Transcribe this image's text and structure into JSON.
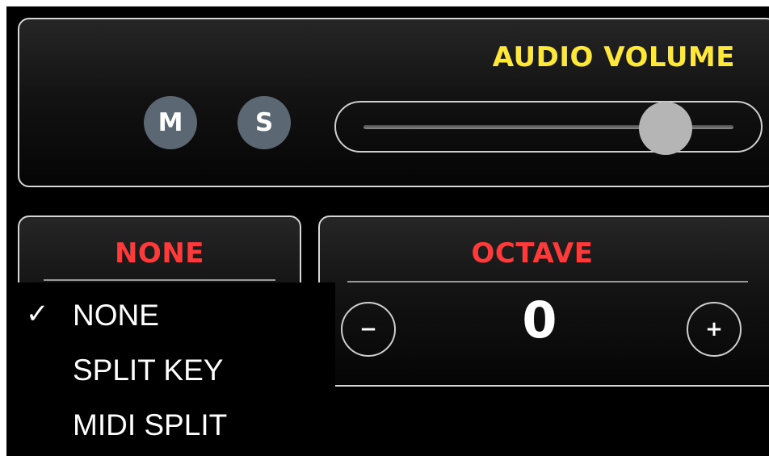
{
  "volume": {
    "title": "AUDIO VOLUME",
    "mute_label": "M",
    "solo_label": "S",
    "level": 0.81
  },
  "split": {
    "title": "NONE",
    "menu": [
      {
        "label": "NONE",
        "checked": true,
        "check_mark": "✓"
      },
      {
        "label": "SPLIT KEY",
        "checked": false,
        "check_mark": ""
      },
      {
        "label": "MIDI SPLIT",
        "checked": false,
        "check_mark": ""
      }
    ]
  },
  "octave": {
    "title": "OCTAVE",
    "value": "0",
    "minus_label": "−",
    "plus_label": "+"
  },
  "colors": {
    "volume_title": "#ffe83a",
    "section_title": "#ff3a3a",
    "button": "#5b6772"
  }
}
